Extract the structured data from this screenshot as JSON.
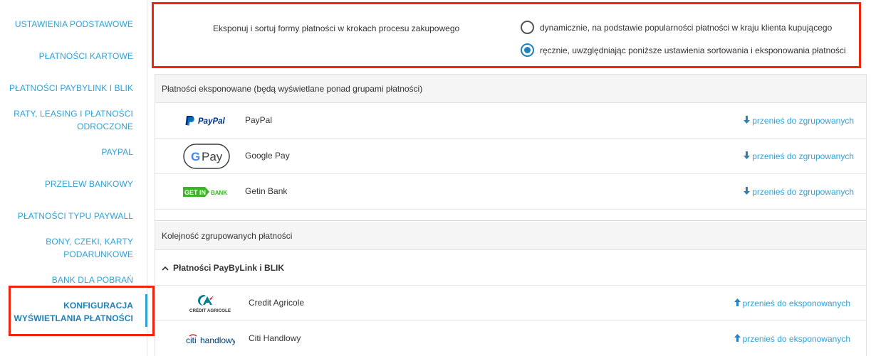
{
  "sidebar": {
    "items": [
      {
        "label": "USTAWIENIA PODSTAWOWE"
      },
      {
        "label": "PŁATNOŚCI KARTOWE"
      },
      {
        "label": "PŁATNOŚCI PAYBYLINK I BLIK"
      },
      {
        "label_line1": "RATY, LEASING I PŁATNOŚCI",
        "label_line2": "ODROCZONE"
      },
      {
        "label": "PAYPAL"
      },
      {
        "label": "PRZELEW BANKOWY"
      },
      {
        "label": "PŁATNOŚCI TYPU PAYWALL"
      },
      {
        "label_line1": "BONY, CZEKI, KARTY",
        "label_line2": "PODARUNKOWE"
      },
      {
        "label": "BANK DLA POBRAŃ"
      },
      {
        "label_line1": "KONFIGURACJA",
        "label_line2": "WYŚWIETLANIA PŁATNOŚCI"
      }
    ],
    "active_index": 9
  },
  "display_option": {
    "label": "Eksponuj i sortuj formy płatności w krokach procesu zakupowego",
    "options": [
      {
        "label": "dynamicznie, na podstawie popularności płatności w kraju klienta kupującego",
        "checked": false
      },
      {
        "label": "ręcznie, uwzględniając poniższe ustawienia sortowania i eksponowania płatności",
        "checked": true
      }
    ]
  },
  "exposed": {
    "title": "Płatności eksponowane (będą wyświetlane ponad grupami płatności)",
    "items": [
      {
        "name": "PayPal",
        "logo": "paypal-logo",
        "action": "przenieś do zgrupowanych"
      },
      {
        "name": "Google Pay",
        "logo": "google-pay-logo",
        "action": "przenieś do zgrupowanych"
      },
      {
        "name": "Getin Bank",
        "logo": "getin-bank-logo",
        "action": "przenieś do zgrupowanych"
      }
    ]
  },
  "grouped": {
    "title": "Kolejność zgrupowanych płatności",
    "group_title": "Płatności PayByLink i BLIK",
    "items": [
      {
        "name": "Credit Agricole",
        "logo": "credit-agricole-logo",
        "action": "przenieś do eksponowanych"
      },
      {
        "name": "Citi Handlowy",
        "logo": "citi-handlowy-logo",
        "action": "przenieś do eksponowanych"
      }
    ]
  },
  "logos": {
    "paypal_text": "PayPal",
    "gpay_text": "Pay",
    "getin_text": "GET IN",
    "getin_bank_text": "BANK",
    "ca_text": "CRÉDIT AGRICOLE",
    "citi_text": "citi",
    "handlowy_text": "handlowy"
  },
  "colors": {
    "accent": "#2ea3d9",
    "highlight_box": "#f0250f",
    "section_bg": "#f5f5f5"
  }
}
